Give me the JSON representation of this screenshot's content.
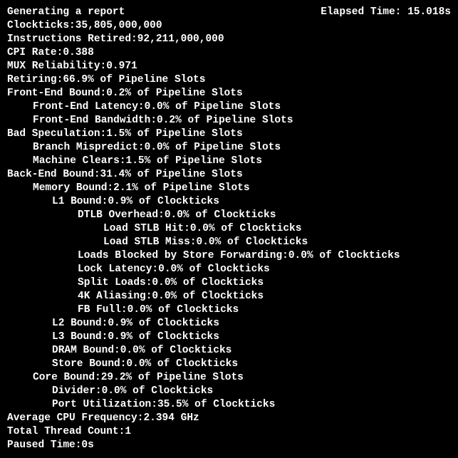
{
  "header": {
    "left": "Generating a report",
    "right_label": "Elapsed Time:",
    "right_value": "15.018s"
  },
  "metrics": {
    "clockticks": {
      "label": "Clockticks:",
      "value": "35,805,000,000"
    },
    "instructions": {
      "label": "Instructions Retired:",
      "value": "92,211,000,000"
    },
    "cpi": {
      "label": "CPI Rate:",
      "value": "0.388"
    },
    "mux": {
      "label": "MUX Reliability:",
      "value": "0.971"
    },
    "retiring": {
      "label": "Retiring:",
      "value": "66.9% of Pipeline Slots"
    },
    "fe_bound": {
      "label": "Front-End Bound:",
      "value": "0.2% of Pipeline Slots"
    },
    "fe_latency": {
      "label": "Front-End Latency:",
      "value": "0.0% of Pipeline Slots"
    },
    "fe_bandwidth": {
      "label": "Front-End Bandwidth:",
      "value": "0.2% of Pipeline Slots"
    },
    "bad_spec": {
      "label": "Bad Speculation:",
      "value": "1.5% of Pipeline Slots"
    },
    "branch_mispredict": {
      "label": "Branch Mispredict:",
      "value": "0.0% of Pipeline Slots"
    },
    "machine_clears": {
      "label": "Machine Clears:",
      "value": "1.5% of Pipeline Slots"
    },
    "be_bound": {
      "label": "Back-End Bound:",
      "value": "31.4% of Pipeline Slots"
    },
    "mem_bound": {
      "label": "Memory Bound:",
      "value": "2.1% of Pipeline Slots"
    },
    "l1_bound": {
      "label": "L1 Bound:",
      "value": "0.9% of Clockticks"
    },
    "dtlb": {
      "label": "DTLB Overhead:",
      "value": "0.0% of Clockticks"
    },
    "stlb_hit": {
      "label": "Load STLB Hit:",
      "value": "0.0% of Clockticks"
    },
    "stlb_miss": {
      "label": "Load STLB Miss:",
      "value": "0.0% of Clockticks"
    },
    "store_fwd": {
      "label": "Loads Blocked by Store Forwarding:",
      "value": "0.0% of Clockticks"
    },
    "lock_latency": {
      "label": "Lock Latency:",
      "value": "0.0% of Clockticks"
    },
    "split_loads": {
      "label": "Split Loads:",
      "value": "0.0% of Clockticks"
    },
    "aliasing_4k": {
      "label": "4K Aliasing:",
      "value": "0.0% of Clockticks"
    },
    "fb_full": {
      "label": "FB Full:",
      "value": "0.0% of Clockticks"
    },
    "l2_bound": {
      "label": "L2 Bound:",
      "value": "0.9% of Clockticks"
    },
    "l3_bound": {
      "label": "L3 Bound:",
      "value": "0.9% of Clockticks"
    },
    "dram_bound": {
      "label": "DRAM Bound:",
      "value": "0.0% of Clockticks"
    },
    "store_bound": {
      "label": "Store Bound:",
      "value": "0.0% of Clockticks"
    },
    "core_bound": {
      "label": "Core Bound:",
      "value": "29.2% of Pipeline Slots"
    },
    "divider": {
      "label": "Divider:",
      "value": "0.0% of Clockticks"
    },
    "port_util": {
      "label": "Port Utilization:",
      "value": "35.5% of Clockticks"
    },
    "cpu_freq": {
      "label": "Average CPU Frequency:",
      "value": "2.394 GHz"
    },
    "thread_count": {
      "label": "Total Thread Count:",
      "value": "1"
    },
    "paused": {
      "label": "Paused Time:",
      "value": "0s"
    }
  }
}
